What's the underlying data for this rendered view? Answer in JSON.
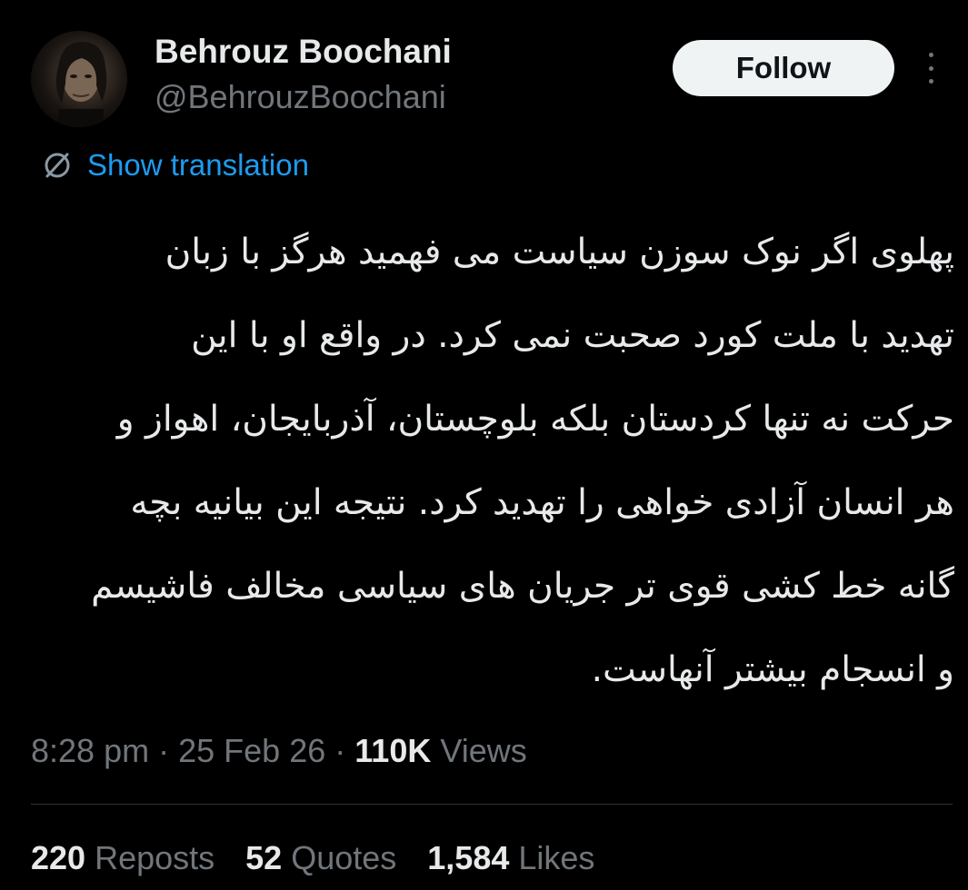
{
  "author": {
    "display_name": "Behrouz Boochani",
    "handle": "@BehrouzBoochani",
    "avatar_alt": "profile photo"
  },
  "actions": {
    "follow_label": "Follow",
    "more_icon": "more-vertical-icon"
  },
  "translation": {
    "icon": "globe-icon",
    "label": "Show translation"
  },
  "tweet": {
    "lines": [
      "پهلوی اگر نوک سوزن سیاست می فهمید هرگز با زبان",
      "تهدید با ملت کورد صحبت نمی کرد. در واقع او با این",
      "حرکت نه تنها کردستان بلکه بلوچستان، آذربایجان، اهواز و",
      "هر انسان آزادی خواهی را تهدید کرد. نتیجه این بیانیه بچه",
      "گانه خط کشی قوی تر جریان های سیاسی مخالف فاشیسم",
      "و انسجام بیشتر  آنهاست."
    ]
  },
  "meta": {
    "time": "8:28 pm",
    "separator": "·",
    "date": "25 Feb 26",
    "views_count": "110K",
    "views_label": "Views"
  },
  "stats": [
    {
      "count": "220",
      "label": "Reposts"
    },
    {
      "count": "52",
      "label": "Quotes"
    },
    {
      "count": "1,584",
      "label": "Likes"
    }
  ],
  "colors": {
    "background": "#000000",
    "primary_text": "#e7e9ea",
    "secondary_text": "#71767b",
    "link": "#1d9bf0",
    "button_bg": "#eff3f4",
    "divider": "#2f3336"
  }
}
